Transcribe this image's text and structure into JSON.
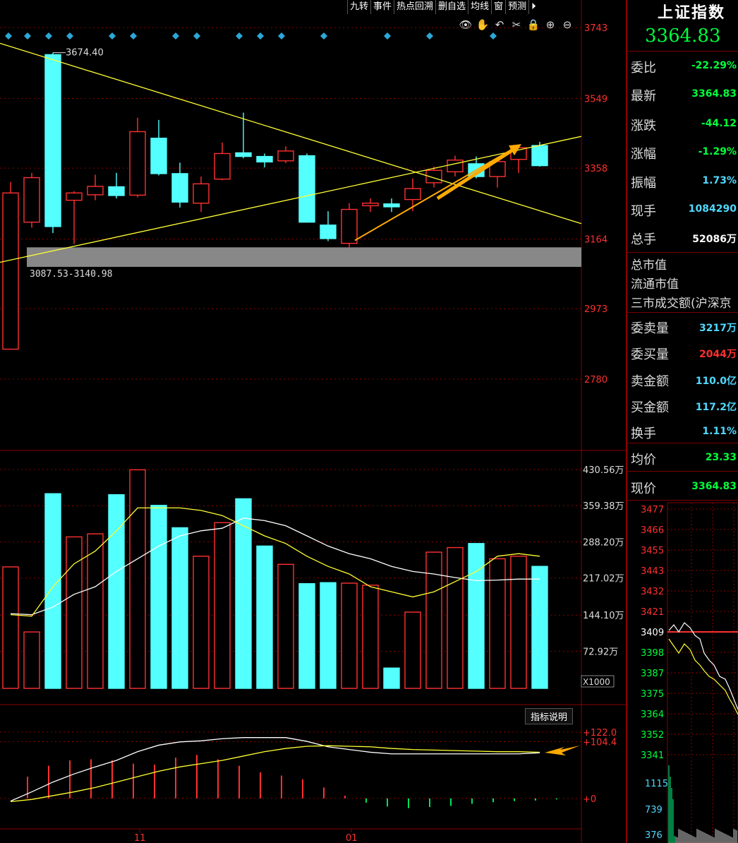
{
  "toolbar": {
    "buttons": [
      "九转",
      "事件",
      "热点回溯",
      "删自选",
      "均线",
      "窗",
      "预测",
      "⏵"
    ]
  },
  "tools": [
    "👁",
    "✋",
    "↶",
    "✂",
    "🔒",
    "⊕",
    "⊖"
  ],
  "colors": {
    "up": "#ff3030",
    "down": "#54ffff",
    "ma5": "#ffff33",
    "ma10": "#ffffff",
    "grid": "#8b0000"
  },
  "chart_data": [
    {
      "type": "candlestick",
      "ylim": [
        2600,
        3780
      ],
      "yticks": [
        "3743",
        "3549",
        "3358",
        "3164",
        "2973",
        "2780"
      ],
      "candles": [
        {
          "o": 2862,
          "h": 3320,
          "l": 2862,
          "c": 3290
        },
        {
          "o": 3210,
          "h": 3345,
          "l": 3195,
          "c": 3332
        },
        {
          "o": 3669,
          "h": 3674.4,
          "l": 3180,
          "c": 3198
        },
        {
          "o": 3270,
          "h": 3295,
          "l": 3150,
          "c": 3290
        },
        {
          "o": 3285,
          "h": 3340,
          "l": 3270,
          "c": 3308
        },
        {
          "o": 3307,
          "h": 3345,
          "l": 3275,
          "c": 3283
        },
        {
          "o": 3284,
          "h": 3496,
          "l": 3278,
          "c": 3458
        },
        {
          "o": 3440,
          "h": 3490,
          "l": 3338,
          "c": 3343
        },
        {
          "o": 3343,
          "h": 3373,
          "l": 3250,
          "c": 3265
        },
        {
          "o": 3262,
          "h": 3335,
          "l": 3238,
          "c": 3315
        },
        {
          "o": 3328,
          "h": 3428,
          "l": 3325,
          "c": 3398
        },
        {
          "o": 3400,
          "h": 3510,
          "l": 3385,
          "c": 3390
        },
        {
          "o": 3390,
          "h": 3398,
          "l": 3360,
          "c": 3375
        },
        {
          "o": 3378,
          "h": 3418,
          "l": 3372,
          "c": 3405
        },
        {
          "o": 3392,
          "h": 3398,
          "l": 3210,
          "c": 3210
        },
        {
          "o": 3202,
          "h": 3240,
          "l": 3158,
          "c": 3165
        },
        {
          "o": 3152,
          "h": 3262,
          "l": 3141,
          "c": 3245
        },
        {
          "o": 3255,
          "h": 3275,
          "l": 3238,
          "c": 3262
        },
        {
          "o": 3260,
          "h": 3275,
          "l": 3238,
          "c": 3252
        },
        {
          "o": 3272,
          "h": 3330,
          "l": 3240,
          "c": 3302
        },
        {
          "o": 3318,
          "h": 3362,
          "l": 3305,
          "c": 3352
        },
        {
          "o": 3348,
          "h": 3392,
          "l": 3335,
          "c": 3380
        },
        {
          "o": 3370,
          "h": 3390,
          "l": 3330,
          "c": 3335
        },
        {
          "o": 3335,
          "h": 3380,
          "l": 3305,
          "c": 3376
        },
        {
          "o": 3382,
          "h": 3420,
          "l": 3345,
          "c": 3414
        },
        {
          "o": 3420,
          "h": 3430,
          "l": 3362,
          "c": 3364.83
        }
      ],
      "annotations": {
        "high_label": "3674.40",
        "zone_label": "3087.53-3140.98",
        "zone": [
          3087.53,
          3140.98
        ]
      },
      "trendlines": [
        [
          0,
          3700,
          27,
          3206
        ],
        [
          0,
          3100,
          27,
          3445
        ]
      ]
    },
    {
      "type": "bar",
      "ylim": [
        0,
        430.56
      ],
      "yticks": [
        "430.56万",
        "359.38万",
        "288.20万",
        "217.02万",
        "144.10万",
        "72.92万"
      ],
      "unit": "X1000",
      "volumes": [
        239,
        111,
        383,
        298,
        304,
        381,
        430,
        360,
        316,
        260,
        326,
        373,
        280,
        244,
        206,
        208,
        207,
        203,
        40,
        150,
        268,
        277,
        285,
        255,
        260,
        240
      ],
      "ma5": [
        145,
        142,
        200,
        245,
        270,
        310,
        355,
        355,
        355,
        350,
        340,
        320,
        300,
        285,
        260,
        240,
        225,
        200,
        190,
        180,
        190,
        210,
        230,
        260,
        265,
        260
      ],
      "ma10": [
        147,
        145,
        160,
        185,
        200,
        230,
        255,
        280,
        300,
        310,
        315,
        335,
        330,
        320,
        300,
        280,
        265,
        255,
        240,
        230,
        225,
        218,
        212,
        213,
        215,
        215
      ]
    },
    {
      "type": "macd",
      "ylim": [
        -25,
        135
      ],
      "yticks": [
        "+122.0",
        "+104.4",
        "+0"
      ],
      "hist": [
        40,
        60,
        70,
        72,
        70,
        64,
        62,
        75,
        80,
        72,
        60,
        48,
        42,
        35,
        20,
        5,
        -8,
        -15,
        -18,
        -16,
        -14,
        -10,
        -7,
        -5,
        -4,
        -2
      ],
      "dif": [
        -5,
        12,
        30,
        45,
        58,
        70,
        86,
        98,
        104,
        106,
        110,
        112,
        112,
        112,
        105,
        95,
        90,
        85,
        82,
        82,
        82,
        82,
        82,
        82,
        82,
        84
      ],
      "dea": [
        -6,
        -2,
        5,
        12,
        20,
        30,
        40,
        50,
        58,
        64,
        70,
        78,
        86,
        92,
        96,
        97,
        96,
        95,
        92,
        90,
        89,
        88,
        87,
        86,
        86,
        85
      ]
    },
    {
      "type": "line",
      "title": "intraday",
      "yticks": [
        "3477",
        "3466",
        "3455",
        "3443",
        "3432",
        "3421",
        "3409",
        "3398",
        "3387",
        "3375",
        "3364",
        "3352",
        "3341"
      ],
      "vticks": [
        "1115",
        "739",
        "376"
      ]
    }
  ],
  "xlabels": [
    "11",
    "01"
  ],
  "macd_button": "指标说明",
  "quote": {
    "title": "上证指数",
    "price": "3364.83",
    "rows": [
      {
        "label": "委比",
        "value": "-22.29%",
        "color": "#00ff3c"
      },
      {
        "label": "最新",
        "value": "3364.83",
        "color": "#00ff3c"
      },
      {
        "label": "涨跌",
        "value": "-44.12",
        "color": "#00ff3c"
      },
      {
        "label": "涨幅",
        "value": "-1.29%",
        "color": "#00ff3c"
      },
      {
        "label": "振幅",
        "value": "1.73%",
        "color": "#4fd8ff"
      },
      {
        "label": "现手",
        "value": "1084290",
        "color": "#4fd8ff"
      },
      {
        "label": "总手",
        "value": "52086万",
        "color": "#ffffff"
      }
    ],
    "plain": [
      "总市值",
      "流通市值",
      "三市成交额(沪深京"
    ],
    "rows2": [
      {
        "label": "委卖量",
        "value": "3217万",
        "color": "#4fd8ff"
      },
      {
        "label": "委买量",
        "value": "2044万",
        "color": "#ff3030"
      },
      {
        "label": "卖金额",
        "value": "110.0亿",
        "color": "#4fd8ff"
      },
      {
        "label": "买金额",
        "value": "117.2亿",
        "color": "#4fd8ff"
      },
      {
        "label": "换手",
        "value": "1.11%",
        "color": "#4fd8ff"
      },
      {
        "label": "均价",
        "value": "23.33",
        "color": "#00ff3c"
      },
      {
        "label": "现价",
        "value": "3364.83",
        "color": "#00ff3c"
      }
    ]
  }
}
